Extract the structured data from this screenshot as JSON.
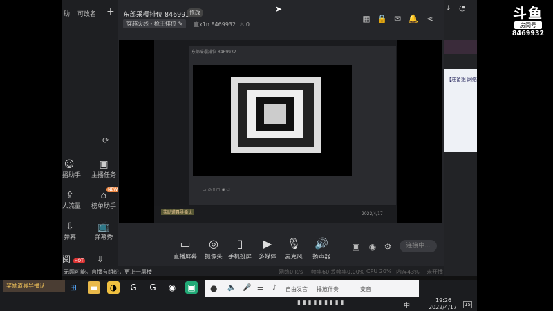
{
  "left_panel": {
    "tab_assistant": "助",
    "tab_audience": "可改名",
    "add": "+",
    "items": [
      {
        "label": "播助手"
      },
      {
        "label": "主播任务"
      },
      {
        "label": "人流量"
      },
      {
        "label": "榜单助手",
        "badge": "NEW"
      },
      {
        "label": "弹幕"
      },
      {
        "label": "弹幕秀"
      }
    ],
    "hot_label": "阅",
    "hot_badge": "HOT"
  },
  "header": {
    "room_title": "东部采樱排位 8469932",
    "edit_label": "修改",
    "category": "穿越火线 - 枪王排位",
    "room_stat_label": "直x1n",
    "room_id": "8469932",
    "fire_count": "0"
  },
  "controls": {
    "items": [
      {
        "label": "直播屏幕",
        "icon": "screen-icon"
      },
      {
        "label": "摄像头",
        "icon": "camera-icon"
      },
      {
        "label": "手机投屏",
        "icon": "phone-icon"
      },
      {
        "label": "多媒体",
        "icon": "media-icon"
      },
      {
        "label": "麦克风",
        "icon": "mic-icon"
      },
      {
        "label": "扬声器",
        "icon": "speaker-icon"
      }
    ],
    "start_label": "连接中..."
  },
  "status_bar": {
    "notice": "无网可能。直播有组织，更上一层楼",
    "net": "网络0 k/s",
    "fps": "帧率60",
    "drop": "丢帧率0.00%",
    "cpu": "CPU 20%",
    "mem": "内存43%",
    "status": "未开播"
  },
  "logo": {
    "brand": "斗鱼",
    "sub": "房间号",
    "room": "8469932"
  },
  "right_strip": {
    "text1": "【准备姐，",
    "text2": "网络"
  },
  "lower_chat": {
    "banner": "奖励道具导播认",
    "mic_label": "自由发言",
    "gift_label": "播放伴奏",
    "effect_label": "变音"
  },
  "taskbar": {
    "time": "19:26",
    "date": "2022/4/17",
    "lang": "中",
    "notif": "15"
  }
}
